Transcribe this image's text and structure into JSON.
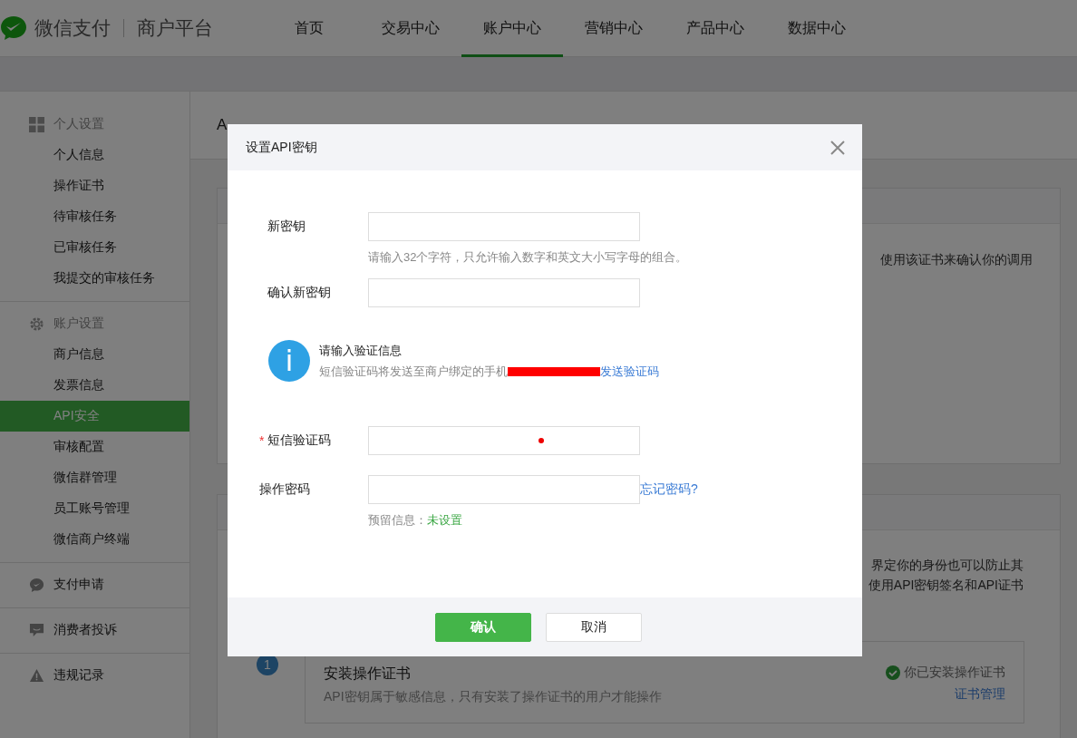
{
  "header": {
    "brand": "微信支付",
    "product": "商户平台",
    "nav": [
      {
        "label": "首页",
        "selected": false
      },
      {
        "label": "交易中心",
        "selected": false
      },
      {
        "label": "账户中心",
        "selected": true
      },
      {
        "label": "营销中心",
        "selected": false
      },
      {
        "label": "产品中心",
        "selected": false
      },
      {
        "label": "数据中心",
        "selected": false
      }
    ]
  },
  "sidebar": {
    "groups": [
      {
        "kind": "grid",
        "title": "个人设置",
        "items": [
          {
            "label": "个人信息",
            "selected": false
          },
          {
            "label": "操作证书",
            "selected": false
          },
          {
            "label": "待审核任务",
            "selected": false
          },
          {
            "label": "已审核任务",
            "selected": false
          },
          {
            "label": "我提交的审核任务",
            "selected": false
          }
        ]
      },
      {
        "kind": "gear",
        "title": "账户设置",
        "items": [
          {
            "label": "商户信息",
            "selected": false
          },
          {
            "label": "发票信息",
            "selected": false
          },
          {
            "label": "API安全",
            "selected": true
          },
          {
            "label": "审核配置",
            "selected": false
          },
          {
            "label": "微信群管理",
            "selected": false
          },
          {
            "label": "员工账号管理",
            "selected": false
          },
          {
            "label": "微信商户终端",
            "selected": false
          }
        ]
      },
      {
        "kind": "pay",
        "title": "支付申请"
      },
      {
        "kind": "chat",
        "title": "消费者投诉"
      },
      {
        "kind": "warning",
        "title": "违规记录"
      }
    ]
  },
  "page": {
    "heading": "A",
    "section_1_text": "使用该证书来确认你的调用",
    "section_2_lines": [
      "界定你的身份也可以防止其",
      "使用API密钥签名和API证书"
    ],
    "step": {
      "number": "1",
      "title": "安装操作证书",
      "description": "API密钥属于敏感信息，只有安装了操作证书的用户才能操作",
      "status": "你已安装操作证书",
      "link": "证书管理"
    }
  },
  "dialog": {
    "title": "设置API密钥",
    "key_fields": [
      {
        "label": "新密钥",
        "hint": "请输入32个字符，只允许输入数字和英文大小写字母的组合。"
      },
      {
        "label": "确认新密钥"
      }
    ],
    "notice": {
      "title": "请输入验证信息",
      "text": "短信验证码将发送至商户绑定的手机",
      "link": "发送验证码"
    },
    "verify_fields": [
      {
        "label": "短信验证码",
        "marker": "*"
      },
      {
        "label": "操作密码",
        "link": "忘记密码?",
        "note_label": "预留信息：",
        "note_value": "未设置"
      }
    ],
    "buttons": [
      {
        "label": "确认",
        "kind": "primary"
      },
      {
        "label": "取消",
        "kind": "secondary"
      }
    ]
  }
}
